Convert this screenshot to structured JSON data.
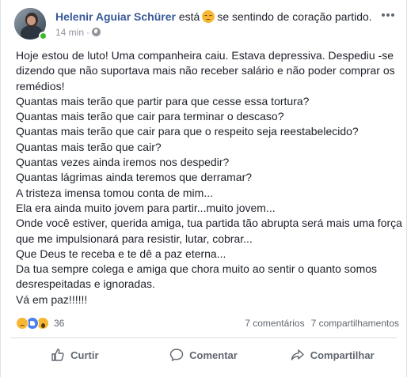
{
  "header": {
    "author": "Helenir Aguiar Schürer",
    "verb": "está",
    "feeling_icon": "sad-face-icon",
    "feeling_text": "se sentindo de coração partido.",
    "time": "14 min",
    "separator": "·",
    "privacy_icon": "globe-icon"
  },
  "body": {
    "lines": [
      "Hoje estou de luto! Uma companheira caiu. Estava depressiva. Despediu -se dizendo que não suportava mais não receber salário e não poder comprar os remédios!",
      "Quantas mais terão que partir para que cesse essa tortura?",
      "Quantas mais terão que cair para terminar o descaso?",
      "Quantas mais terão que cair para que o respeito seja reestabelecido?",
      "Quantas mais terão que cair?",
      "Quantas vezes ainda iremos nos despedir?",
      "Quantas lágrimas ainda teremos que derramar?",
      "A tristeza imensa tomou conta de mim...",
      "Ela era ainda muito jovem para partir...muito jovem...",
      "Onde você estiver, querida amiga, tua partida tão abrupta será mais uma força que me impulsionará para resistir, lutar, cobrar...",
      "Que Deus te receba e te dê a paz eterna...",
      "Da tua sempre colega e amiga que chora muito ao sentir o quanto somos desrespeitadas e ignoradas.",
      "Vá em paz!!!!!!"
    ]
  },
  "stats": {
    "reaction_icons": [
      "sad-reaction-icon",
      "like-reaction-icon",
      "wow-reaction-icon"
    ],
    "reaction_count": "36",
    "comments": "7 comentários",
    "shares": "7 compartilhamentos"
  },
  "actions": {
    "like": "Curtir",
    "comment": "Comentar",
    "share": "Compartilhar"
  },
  "colors": {
    "author": "#365899",
    "meta": "#90949c",
    "action": "#606770",
    "online": "#42b72a"
  }
}
